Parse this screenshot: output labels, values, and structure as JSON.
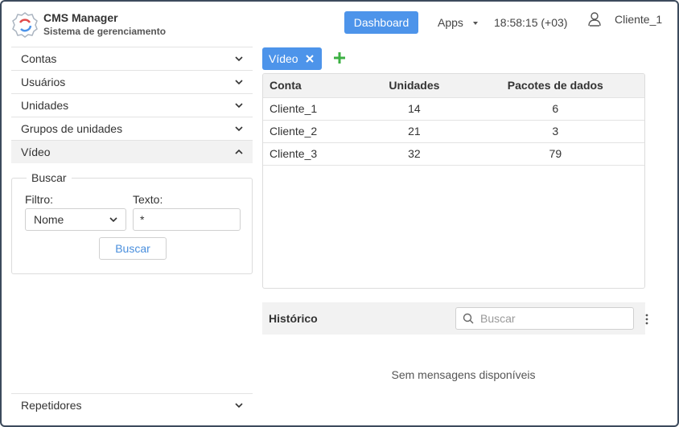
{
  "brand": {
    "title": "CMS Manager",
    "subtitle": "Sistema de gerenciamento"
  },
  "header": {
    "dashboard_label": "Dashboard",
    "apps_label": "Apps",
    "clock": "18:58:15 (+03)",
    "user": "Cliente_1"
  },
  "sidebar": {
    "items": [
      {
        "label": "Contas"
      },
      {
        "label": "Usuários"
      },
      {
        "label": "Unidades"
      },
      {
        "label": "Grupos de unidades"
      },
      {
        "label": "Vídeo",
        "expanded": true
      }
    ],
    "bottom_item": {
      "label": "Repetidores"
    },
    "search": {
      "legend": "Buscar",
      "filter_label": "Filtro:",
      "filter_value": "Nome",
      "text_label": "Texto:",
      "text_value": "*",
      "button_label": "Buscar"
    }
  },
  "tabs": [
    {
      "label": "Vídeo"
    }
  ],
  "table": {
    "columns": [
      "Conta",
      "Unidades",
      "Pacotes de dados"
    ],
    "rows": [
      [
        "Cliente_1",
        "14",
        "6"
      ],
      [
        "Cliente_2",
        "21",
        "3"
      ],
      [
        "Cliente_3",
        "32",
        "79"
      ]
    ]
  },
  "history": {
    "title": "Histórico",
    "search_placeholder": "Buscar",
    "empty_message": "Sem mensagens disponíveis"
  },
  "colors": {
    "accent": "#4d94ea",
    "add_icon": "#3cb043",
    "frame": "#3c4a5c"
  },
  "icons": {
    "logo": "gear-logo-icon",
    "user": "user-icon",
    "chevron": "chevron-down-icon",
    "add": "plus-icon",
    "close": "close-icon",
    "search": "search-icon",
    "menu": "more-vertical-icon"
  }
}
